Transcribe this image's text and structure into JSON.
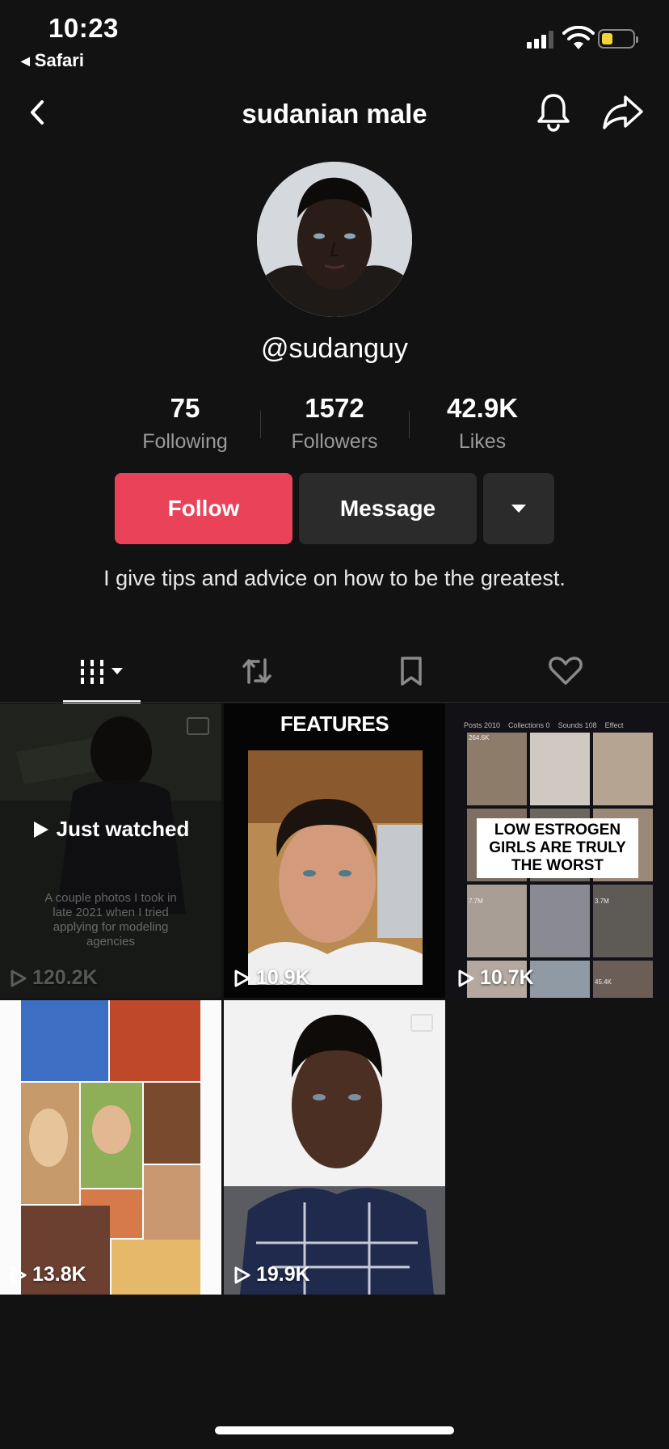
{
  "status_bar": {
    "time": "10:23",
    "back_app": "Safari",
    "battery_color": "#f5d43a"
  },
  "header": {
    "title": "sudanian male",
    "back_icon": "chevron-left-icon",
    "bell_icon": "bell-icon",
    "share_icon": "share-icon"
  },
  "profile": {
    "username": "@sudanguy",
    "stats": [
      {
        "value": "75",
        "label": "Following"
      },
      {
        "value": "1572",
        "label": "Followers"
      },
      {
        "value": "42.9K",
        "label": "Likes"
      }
    ],
    "buttons": {
      "follow": "Follow",
      "message": "Message"
    },
    "bio": "I give tips and advice on how to be the greatest.",
    "follow_color": "#ea4359"
  },
  "tabs": [
    {
      "name": "videos",
      "icon": "grid-icon",
      "active": true
    },
    {
      "name": "reposts",
      "icon": "repost-icon",
      "active": false
    },
    {
      "name": "favorites",
      "icon": "bookmark-icon",
      "active": false
    },
    {
      "name": "liked",
      "icon": "heart-icon",
      "active": false
    }
  ],
  "videos": [
    {
      "views": "120.2K",
      "overlay": "Just watched",
      "caption": "A couple photos I took in late 2021 when I tried applying for modeling agencies"
    },
    {
      "views": "10.9K",
      "overlay_text": "FEATURES"
    },
    {
      "views": "10.7K",
      "overlay_text": "LOW ESTROGEN GIRLS ARE TRULY THE WORST",
      "inner_tabs": [
        "Posts 2010",
        "Collections 0",
        "Sounds 108",
        "Effect"
      ],
      "inner_counts": [
        "264.6K",
        "7.7M",
        "3.7M",
        "45.4K"
      ]
    },
    {
      "views": "13.8K"
    },
    {
      "views": "19.9K"
    }
  ]
}
